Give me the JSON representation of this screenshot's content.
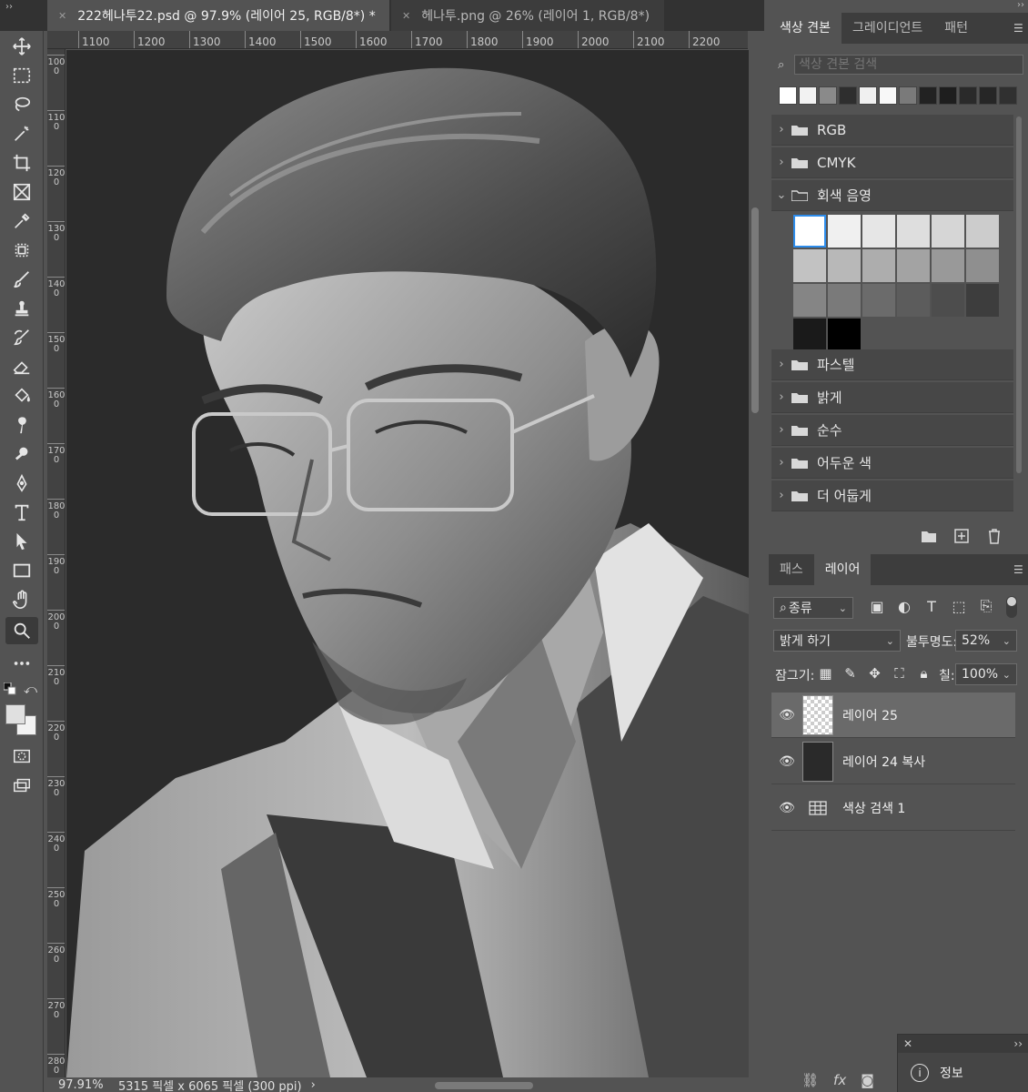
{
  "tabs": [
    {
      "label": "222헤나투22.psd @ 97.9% (레이어 25, RGB/8*) *",
      "active": true
    },
    {
      "label": "헤나투.png @ 26% (레이어 1, RGB/8*)",
      "active": false
    }
  ],
  "ruler_h": [
    "1100",
    "1200",
    "1300",
    "1400",
    "1500",
    "1600",
    "1700",
    "1800",
    "1900",
    "2000",
    "2100",
    "2200"
  ],
  "ruler_v": [
    "1000",
    "1100",
    "1200",
    "1300",
    "1400",
    "1500",
    "1600",
    "1700",
    "1800",
    "1900",
    "2000",
    "2100",
    "2200",
    "2300",
    "2400",
    "2500",
    "2600",
    "2700",
    "2800"
  ],
  "status": {
    "zoom": "97.91%",
    "doc_info": "5315 픽셀 x 6065 픽셀 (300 ppi)",
    "arrow": "›"
  },
  "swatches_panel": {
    "tabs": [
      "색상 견본",
      "그레이디언트",
      "패턴"
    ],
    "search_placeholder": "색상 견본 검색",
    "recent_colors": [
      "#ffffff",
      "#f2f2f2",
      "#8a8a8a",
      "#2e2e2e",
      "#f0f0f0",
      "#f8f8f8",
      "#7a7a7a",
      "#222222",
      "#1e1e1e",
      "#2a2a2a",
      "#262626",
      "#303030"
    ],
    "groups_top": [
      "RGB",
      "CMYK",
      "회색 음영"
    ],
    "gray_swatches": [
      "#ffffff",
      "#f0f0f0",
      "#e6e6e6",
      "#dedede",
      "#d6d6d6",
      "#cccccc",
      "#c2c2c2",
      "#b8b8b8",
      "#adadad",
      "#a3a3a3",
      "#999999",
      "#8f8f8f",
      "#858585",
      "#7a7a7a",
      "#6b6b6b",
      "#5c5c5c",
      "#4d4d4d",
      "#3d3d3d",
      "#1a1a1a",
      "#000000"
    ],
    "groups_bottom": [
      "파스텔",
      "밝게",
      "순수",
      "어두운 색",
      "더 어둡게"
    ]
  },
  "layers_panel": {
    "tabs": [
      "패스",
      "레이어"
    ],
    "filter_kind": "종류",
    "blend_mode": "밝게 하기",
    "opacity_label": "불투명도:",
    "opacity_value": "52%",
    "lock_label": "잠그기:",
    "fill_label": "칠:",
    "fill_value": "100%",
    "layers": [
      {
        "name": "레이어 25",
        "selected": true
      },
      {
        "name": "레이어 24 복사",
        "selected": false
      },
      {
        "name": "색상 검색 1",
        "selected": false
      }
    ]
  },
  "info_panel": {
    "title": "정보"
  }
}
